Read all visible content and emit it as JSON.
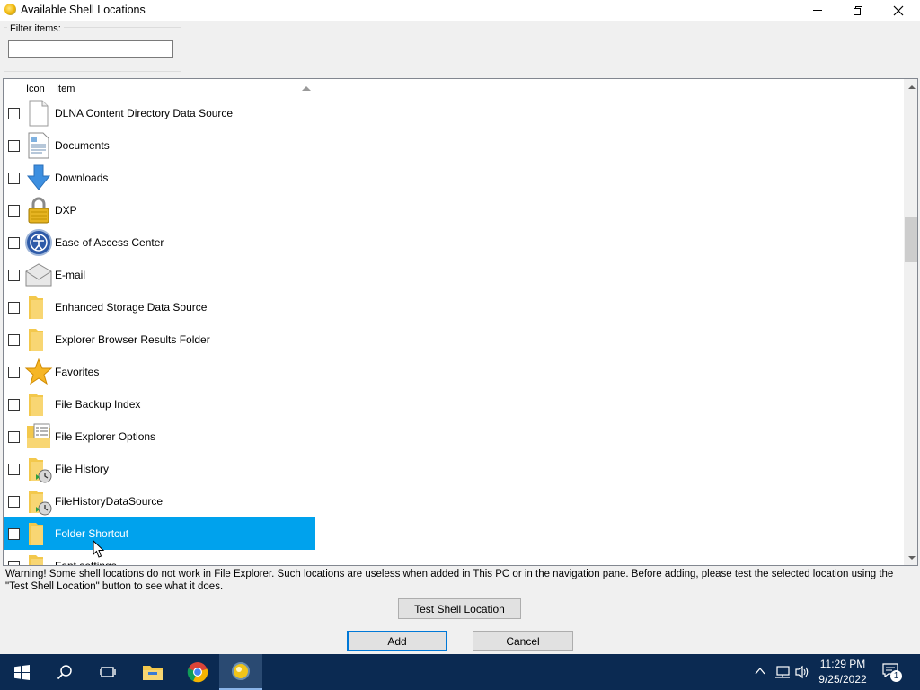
{
  "window": {
    "title": "Available Shell Locations"
  },
  "filter": {
    "label": "Filter items:",
    "value": ""
  },
  "list": {
    "columns": [
      "Icon",
      "Item"
    ],
    "sort_column": "Item",
    "sort_direction": "ascending",
    "items": [
      {
        "label": "DLNA Content Directory Data Source",
        "icon": "blank-document-icon",
        "checked": false,
        "selected": false
      },
      {
        "label": "Documents",
        "icon": "documents-icon",
        "checked": false,
        "selected": false
      },
      {
        "label": "Downloads",
        "icon": "download-arrow-icon",
        "checked": false,
        "selected": false
      },
      {
        "label": "DXP",
        "icon": "padlock-icon",
        "checked": false,
        "selected": false
      },
      {
        "label": "Ease of Access Center",
        "icon": "ease-of-access-icon",
        "checked": false,
        "selected": false
      },
      {
        "label": "E-mail",
        "icon": "envelope-icon",
        "checked": false,
        "selected": false
      },
      {
        "label": "Enhanced Storage Data Source",
        "icon": "folder-icon",
        "checked": false,
        "selected": false
      },
      {
        "label": "Explorer Browser Results Folder",
        "icon": "folder-icon",
        "checked": false,
        "selected": false
      },
      {
        "label": "Favorites",
        "icon": "star-icon",
        "checked": false,
        "selected": false
      },
      {
        "label": "File Backup Index",
        "icon": "folder-icon",
        "checked": false,
        "selected": false
      },
      {
        "label": "File Explorer Options",
        "icon": "folder-options-icon",
        "checked": false,
        "selected": false
      },
      {
        "label": "File History",
        "icon": "folder-history-icon",
        "checked": false,
        "selected": false
      },
      {
        "label": "FileHistoryDataSource",
        "icon": "folder-history-icon",
        "checked": false,
        "selected": false
      },
      {
        "label": "Folder Shortcut",
        "icon": "folder-icon",
        "checked": false,
        "selected": true
      },
      {
        "label": "Font settings",
        "icon": "folder-icon",
        "checked": false,
        "selected": false
      }
    ]
  },
  "warning_text": "Warning! Some shell locations do not work in File Explorer. Such locations are useless when added in This PC or in the navigation pane. Before adding, please test the selected location using the \"Test Shell Location\" button to see what it does.",
  "buttons": {
    "test": "Test Shell Location",
    "add": "Add",
    "cancel": "Cancel"
  },
  "taskbar": {
    "time": "11:29 PM",
    "date": "9/25/2022",
    "notification_count": "1",
    "apps": [
      "start-icon",
      "search-icon",
      "task-view-icon",
      "file-explorer-icon",
      "chrome-icon",
      "winaero-tweaker-icon"
    ]
  },
  "colors": {
    "selection": "#00a2ed",
    "taskbar": "#0b2a52",
    "folder": "#f3c84c"
  }
}
